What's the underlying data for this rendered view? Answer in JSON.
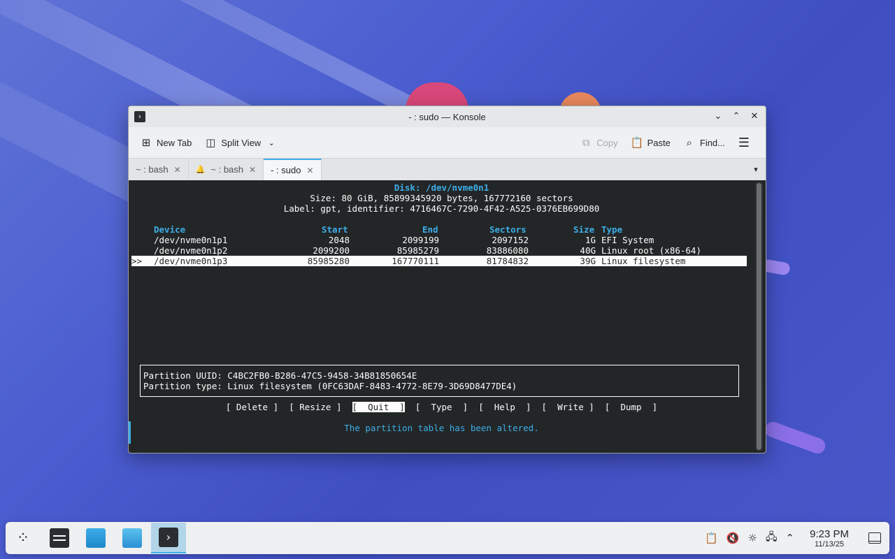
{
  "window": {
    "title": "- : sudo — Konsole",
    "controls": [
      "minimize",
      "maximize",
      "close"
    ]
  },
  "toolbar": {
    "new_tab": "New Tab",
    "split_view": "Split View",
    "copy": "Copy",
    "paste": "Paste",
    "find": "Find..."
  },
  "tabs": [
    {
      "label": "~ : bash",
      "active": false
    },
    {
      "label": "~ : bash",
      "active": false,
      "bell": true
    },
    {
      "label": "- : sudo",
      "active": true
    }
  ],
  "terminal": {
    "disk_line": "Disk: /dev/nvme0n1",
    "size_line": "Size: 80 GiB, 85899345920 bytes, 167772160 sectors",
    "label_line": "Label: gpt, identifier: 4716467C-7290-4F42-A525-0376EB699D80",
    "columns": [
      "Device",
      "Start",
      "End",
      "Sectors",
      "Size",
      "Type"
    ],
    "rows": [
      {
        "device": "/dev/nvme0n1p1",
        "start": "2048",
        "end": "2099199",
        "sectors": "2097152",
        "size": "1G",
        "type": "EFI System",
        "selected": false
      },
      {
        "device": "/dev/nvme0n1p2",
        "start": "2099200",
        "end": "85985279",
        "sectors": "83886080",
        "size": "40G",
        "type": "Linux root (x86-64)",
        "selected": false
      },
      {
        "device": "/dev/nvme0n1p3",
        "start": "85985280",
        "end": "167770111",
        "sectors": "81784832",
        "size": "39G",
        "type": "Linux filesystem",
        "selected": true
      }
    ],
    "selector": ">>",
    "info_uuid": "Partition UUID: C4BC2FB0-B286-47C5-9458-34B81850654E",
    "info_type": "Partition type: Linux filesystem (0FC63DAF-8483-4772-8E79-3D69D8477DE4)",
    "menu_buttons": [
      "Delete",
      "Resize",
      "Quit",
      "Type",
      "Help",
      "Write",
      "Dump"
    ],
    "selected_button": "Quit",
    "status": "The partition table has been altered."
  },
  "taskbar": {
    "clock_time": "9:23 PM",
    "clock_date": "11/13/25"
  }
}
